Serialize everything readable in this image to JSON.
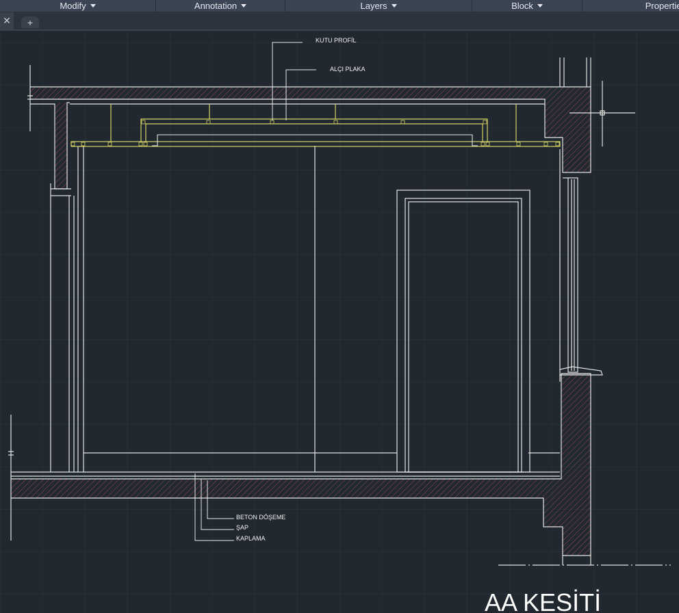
{
  "ribbon": {
    "panels": [
      {
        "label": "Modify"
      },
      {
        "label": "Annotation"
      },
      {
        "label": "Layers"
      },
      {
        "label": "Block"
      },
      {
        "label": "Properties"
      }
    ]
  },
  "tabs": {
    "close_glyph": "✕",
    "add_glyph": "+"
  },
  "drawing": {
    "title": "AA KESİTİ",
    "labels": {
      "kutu_profil": "KUTU PROFİL",
      "alci_plaka": "ALÇI PLAKA",
      "beton_doseme": "BETON DÖŞEME",
      "sap": "ŞAP",
      "kaplama": "KAPLAMA"
    }
  },
  "colors": {
    "background": "#212830",
    "grid": "#2b3440",
    "linework": "#e6e6e6",
    "hatch": "#8a4752",
    "ceiling_profile": "#d7d567"
  }
}
